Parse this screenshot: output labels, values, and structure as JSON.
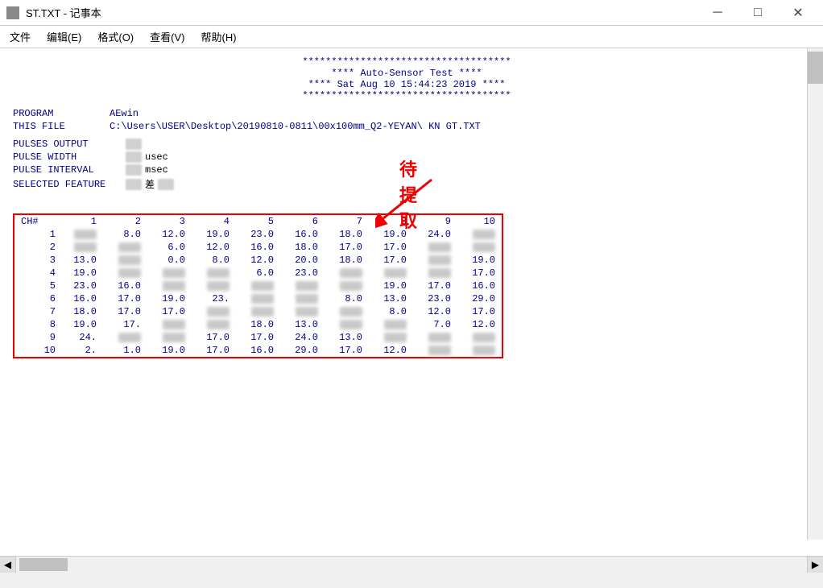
{
  "titleBar": {
    "title": "ST.TXT - 记事本",
    "minimizeLabel": "─",
    "maximizeLabel": "□",
    "closeLabel": "✕"
  },
  "menuBar": {
    "items": [
      "文件",
      "编辑(E)",
      "格式(O)",
      "查看(V)",
      "帮助(H)"
    ]
  },
  "header": {
    "line1": "************************************",
    "line2": "****        Auto-Sensor Test        ****",
    "line3": "****  Sat Aug 10 15:44:23 2019  ****",
    "line4": "************************************"
  },
  "program": {
    "label1": "PROGRAM",
    "value1": "AEwin",
    "label2": "THIS FILE",
    "value2": "C:\\Users\\USER\\Desktop\\20190810-0811\\00x100mm_Q2-YEYAN\\ KN  GT.TXT"
  },
  "pulses": {
    "outputLabel": "PULSES OUTPUT",
    "pulseWidthLabel": "PULSE WIDTH",
    "pulseWidthUnit": "usec",
    "pulseIntervalLabel": "PULSE INTERVAL",
    "pulseIntervalUnit": "msec",
    "selectedFeatureLabel": "SELECTED FEATURE",
    "selectedFeatureValue": "差"
  },
  "annotation": {
    "text": "待提取"
  },
  "table": {
    "chHeader": "CH#",
    "columns": [
      "1",
      "2",
      "3",
      "4",
      "5",
      "6",
      "7",
      "8",
      "9",
      "10"
    ],
    "rows": [
      {
        "rowNum": "1",
        "cells": [
          "",
          "8.0",
          "12.0",
          "19.0",
          "23.0",
          "16.0",
          "18.0",
          "19.0",
          "24.0",
          ""
        ]
      },
      {
        "rowNum": "2",
        "cells": [
          "",
          "",
          "6.0",
          "12.0",
          "16.0",
          "18.0",
          "17.0",
          "17.0",
          "",
          ""
        ]
      },
      {
        "rowNum": "3",
        "cells": [
          "13.0",
          "",
          "0.0",
          "8.0",
          "12.0",
          "20.0",
          "18.0",
          "17.0",
          "",
          "19.0"
        ]
      },
      {
        "rowNum": "4",
        "cells": [
          "19.0",
          "",
          "",
          "",
          "6.0",
          "23.0",
          "",
          "",
          "",
          "17.0"
        ]
      },
      {
        "rowNum": "5",
        "cells": [
          "23.0",
          "16.0",
          "",
          "",
          "",
          "",
          "",
          "19.0",
          "17.0",
          "16.0"
        ]
      },
      {
        "rowNum": "6",
        "cells": [
          "16.0",
          "17.0",
          "19.0",
          "23.",
          "",
          "",
          "8.0",
          "13.0",
          "23.0",
          "29.0"
        ]
      },
      {
        "rowNum": "7",
        "cells": [
          "18.0",
          "17.0",
          "17.0",
          "",
          "",
          "",
          "",
          "8.0",
          "12.0",
          "17.0"
        ]
      },
      {
        "rowNum": "8",
        "cells": [
          "19.0",
          "17.",
          "",
          "",
          "18.0",
          "13.0",
          "",
          "",
          "7.0",
          "12.0"
        ]
      },
      {
        "rowNum": "9",
        "cells": [
          "24.",
          "",
          "",
          "17.0",
          "17.0",
          "24.0",
          "13.0",
          "",
          "",
          ""
        ]
      },
      {
        "rowNum": "10",
        "cells": [
          "2.",
          "1.0",
          "19.0",
          "17.0",
          "16.0",
          "29.0",
          "17.0",
          "12.0",
          "",
          ""
        ]
      }
    ]
  }
}
